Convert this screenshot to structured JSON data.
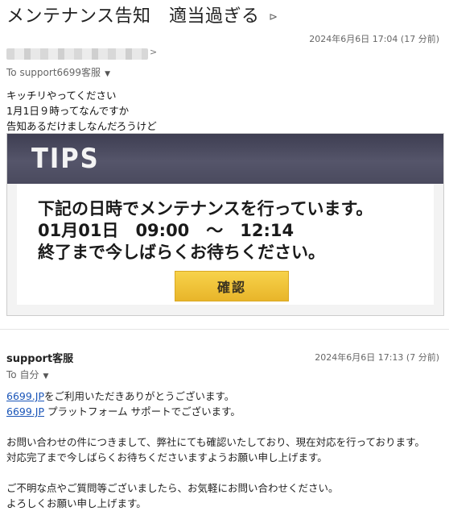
{
  "email": {
    "subject": "メンテナンス告知　適当過ぎる",
    "label_icon": "label-icon",
    "date": "2024年6月6日 17:04 (17 分前)",
    "sender_caret": ">",
    "to": "To support6699客服",
    "body_lines": [
      "キッチリやってください",
      "1月1日９時ってなんですか",
      "告知あるだけましなんだろうけど"
    ]
  },
  "tips_image": {
    "header": "TIPS",
    "lines": [
      "下記の日時でメンテナンスを行っています。",
      "01月01日　09:00　～　12:14",
      "終了まで今しばらくお待ちください。"
    ],
    "button": "確認"
  },
  "reply": {
    "sender": "support客服",
    "date": "2024年6月6日 17:13 (7 分前)",
    "to": "To 自分",
    "link1": "6699.JP",
    "line1_rest": "をご利用いただきありがとうございます。",
    "link2": "6699.JP",
    "line2_rest": " プラットフォーム サポートでございます。",
    "para2_lines": [
      "お問い合わせの件につきまして、弊社にても確認いたしており、現在対応を行っております。",
      "対応完了まで今しばらくお待ちくださいますようお願い申し上げます。"
    ],
    "para3_lines": [
      "ご不明な点やご質問等ございましたら、お気軽にお問い合わせください。",
      "よろしくお願い申し上げます。"
    ]
  },
  "colors": {
    "link": "#1a55b8",
    "button": "#f2c63c",
    "tips_header": "#4a4a5e"
  }
}
